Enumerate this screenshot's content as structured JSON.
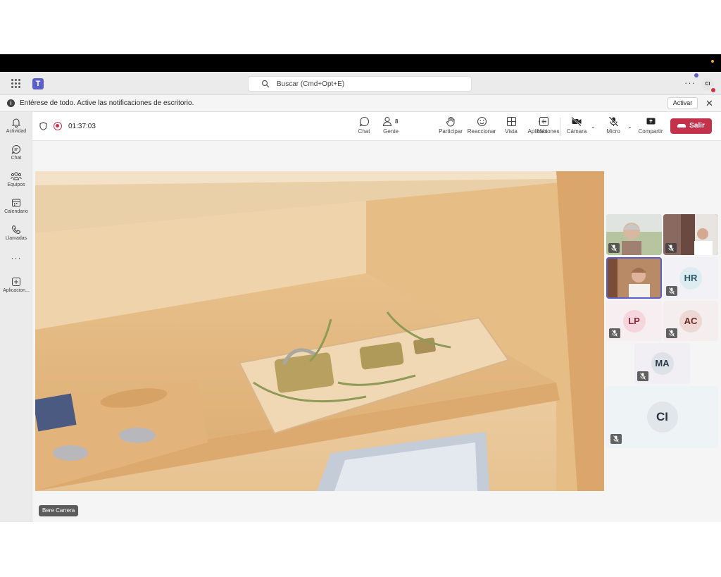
{
  "search": {
    "placeholder": "Buscar (Cmd+Opt+E)"
  },
  "user": {
    "initials": "CI"
  },
  "notification": {
    "message": "Entérese de todo. Active las notificaciones de escritorio.",
    "action_label": "Activar"
  },
  "rail": {
    "items": [
      {
        "label": "Actividad",
        "icon": "bell-icon"
      },
      {
        "label": "Chat",
        "icon": "chat-icon"
      },
      {
        "label": "Equipos",
        "icon": "teams-icon"
      },
      {
        "label": "Calendario",
        "icon": "calendar-icon"
      },
      {
        "label": "Llamadas",
        "icon": "phone-icon"
      },
      {
        "label": "Aplicacion...",
        "icon": "apps-icon"
      }
    ]
  },
  "meeting": {
    "timer": "01:37:03",
    "toolbar": {
      "chat": "Chat",
      "people": "Gente",
      "people_count": "8",
      "raise": "Participar",
      "react": "Reaccionar",
      "view": "Vista",
      "apps": "Aplicaciones",
      "more": "Más",
      "camera": "Cámara",
      "mic": "Micro",
      "share": "Compartir",
      "leave": "Salir"
    },
    "colors": {
      "leave": "#c4314b",
      "brand": "#5b5fc7"
    },
    "main_speaker": "Bere Carrera",
    "participants": [
      {
        "initials": "HR"
      },
      {
        "initials": "LP"
      },
      {
        "initials": "AC"
      },
      {
        "initials": "MA"
      },
      {
        "initials": "CI"
      }
    ]
  }
}
